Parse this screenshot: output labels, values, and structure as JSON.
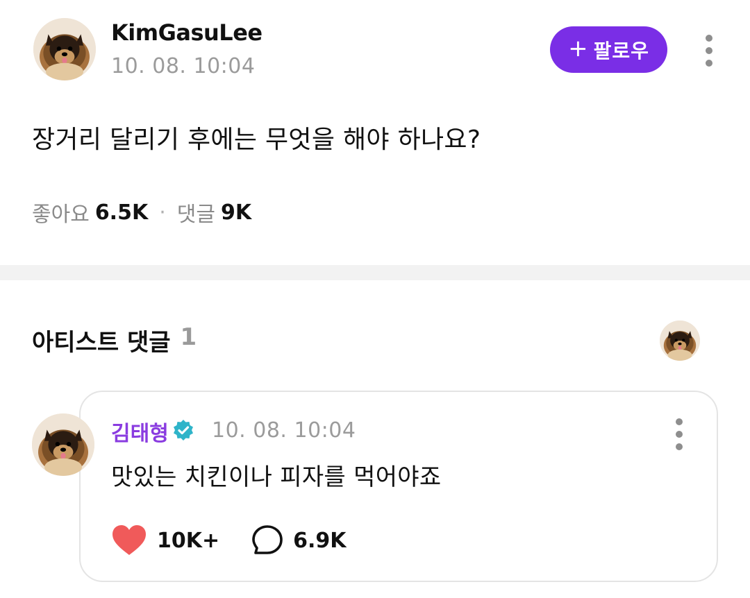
{
  "post": {
    "author": "KimGasuLee",
    "time": "10. 08. 10:04",
    "follow_plus": "+",
    "follow_label": "팔로우",
    "question": "장거리 달리기 후에는 무엇을 해야 하나요?",
    "likes_label": "좋아요",
    "likes_count": "6.5K",
    "separator": "·",
    "comments_label": "댓글",
    "comments_count": "9K"
  },
  "artist_comments": {
    "title": "아티스트 댓글",
    "count": "1"
  },
  "comment": {
    "author": "김태형",
    "verified_icon": "verified-check-icon",
    "time": "10. 08. 10:04",
    "text": "맛있는 치킨이나 피자를 먹어야죠",
    "likes": "10K+",
    "replies": "6.9K"
  },
  "colors": {
    "accent": "#7a2ee6",
    "artist_name": "#8a3ce0",
    "verified": "#2fb4c9",
    "heart": "#f05a5a"
  }
}
